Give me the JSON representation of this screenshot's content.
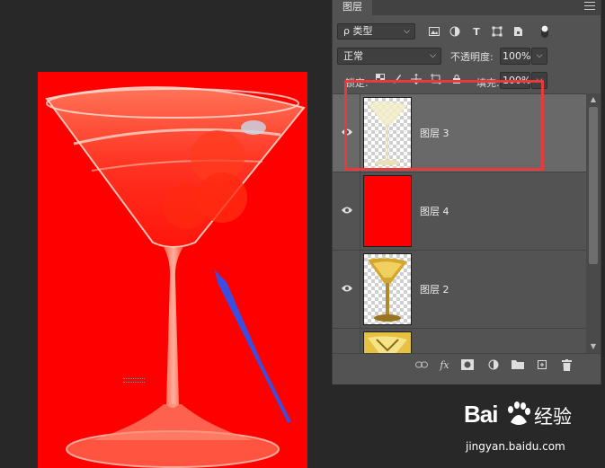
{
  "panel": {
    "tab_label": "图层",
    "filter": {
      "label": "ρ 类型",
      "chevron": "⌵"
    },
    "filter_icons": [
      "image-filter-icon",
      "adjustment-filter-icon",
      "type-filter-icon",
      "shape-filter-icon",
      "smart-object-filter-icon",
      "filter-toggle-icon"
    ],
    "type_icon_glyph": "T",
    "blend_mode": "正常",
    "opacity_label": "不透明度:",
    "opacity_value": "100%",
    "lock_label": "锁定:",
    "fill_label": "填充:",
    "fill_value": "100%",
    "dropdown_chevron": "⌵",
    "layers": [
      {
        "name": "图层 3",
        "selected": true,
        "thumb": "transparent-glass"
      },
      {
        "name": "图层 4",
        "selected": false,
        "thumb": "solid-red"
      },
      {
        "name": "图层 2",
        "selected": false,
        "thumb": "gold-glass"
      },
      {
        "name": "",
        "selected": false,
        "thumb": "gold-glass-yellow"
      }
    ],
    "bottom_icons": [
      "link-layers-icon",
      "fx-icon",
      "layer-mask-icon",
      "adjustment-layer-icon",
      "new-group-icon",
      "new-layer-icon",
      "delete-layer-icon"
    ],
    "fx_label": "fx"
  },
  "canvas": {
    "background_color": "#ff0000"
  },
  "annotation": {
    "highlight_color": "#e8393c",
    "arrow_color": "#3b4ee0"
  },
  "watermark": {
    "logo_text": "Bai",
    "logo_suffix": "经验",
    "url": "jingyan.baidu.com"
  }
}
